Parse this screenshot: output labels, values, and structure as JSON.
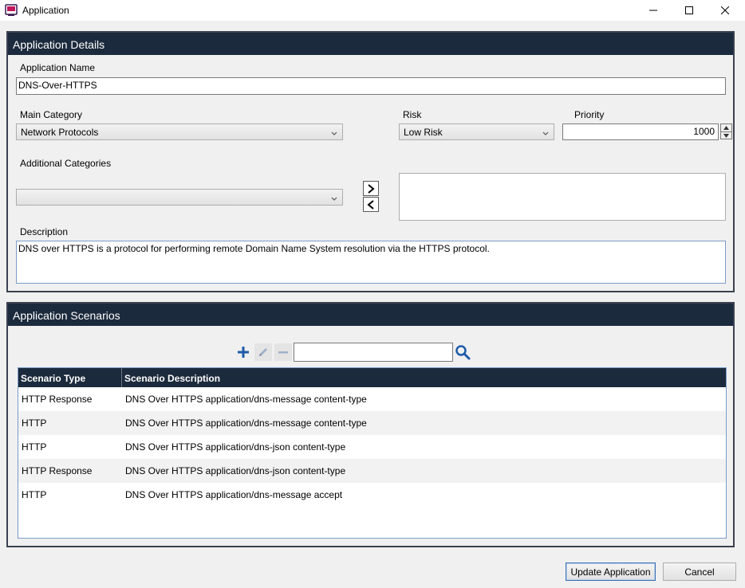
{
  "window": {
    "title": "Application",
    "icon": "application-icon",
    "controls": [
      "minimize-icon",
      "maximize-icon",
      "close-icon"
    ]
  },
  "details": {
    "header": "Application Details",
    "name_label": "Application Name",
    "name_value": "DNS-Over-HTTPS",
    "main_category_label": "Main Category",
    "main_category_value": "Network Protocols",
    "risk_label": "Risk",
    "risk_value": "Low Risk",
    "priority_label": "Priority",
    "priority_value": "1000",
    "additional_categories_label": "Additional Categories",
    "additional_categories_value": "",
    "description_label": "Description",
    "description_value": "DNS over HTTPS is a protocol for performing remote Domain Name System resolution via the HTTPS protocol."
  },
  "scenarios": {
    "header": "Application Scenarios",
    "search_value": "",
    "columns": [
      "Scenario Type",
      "Scenario Description"
    ],
    "rows": [
      {
        "type": "HTTP Response",
        "description": "DNS Over HTTPS application/dns-message content-type"
      },
      {
        "type": "HTTP",
        "description": "DNS Over HTTPS application/dns-message content-type"
      },
      {
        "type": "HTTP",
        "description": "DNS Over HTTPS application/dns-json content-type"
      },
      {
        "type": "HTTP Response",
        "description": "DNS Over HTTPS application/dns-json content-type"
      },
      {
        "type": "HTTP",
        "description": "DNS Over HTTPS application/dns-message accept"
      }
    ]
  },
  "footer": {
    "update_label": "Update Application",
    "cancel_label": "Cancel"
  },
  "colors": {
    "header_bg": "#1c2a3d",
    "accent": "#1e5aa8"
  }
}
